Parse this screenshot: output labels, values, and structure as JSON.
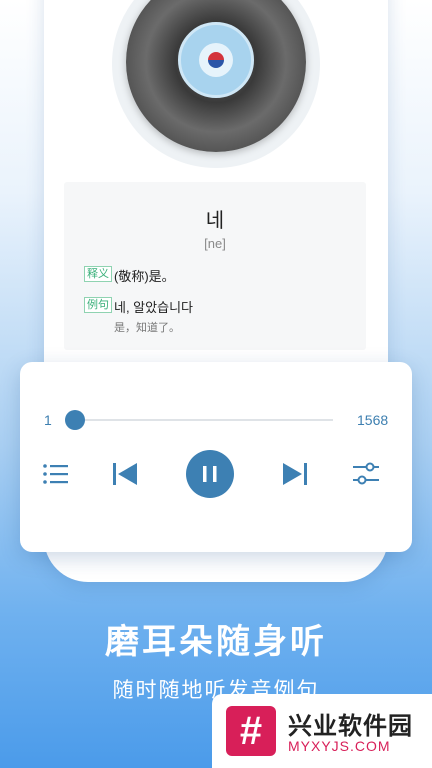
{
  "flashcard": {
    "word": "네",
    "phonetic": "[ne]",
    "meaning_tag": "释义",
    "meaning": "(敬称)是。",
    "example_tag": "例句",
    "example": "네, 알았습니다",
    "example_translation": "是，知道了。"
  },
  "player": {
    "progress_current": "1",
    "progress_total": "1568",
    "progress_fraction": 0.0,
    "icons": [
      "list-icon",
      "previous-icon",
      "pause-icon",
      "next-icon",
      "settings-sliders-icon"
    ]
  },
  "promo": {
    "headline": "磨耳朵随身听",
    "subline": "随时随地听发音例句"
  },
  "watermark": {
    "logo_char": "#",
    "title": "兴业软件园",
    "url": "MYXYJS.COM"
  },
  "colors": {
    "accent": "#3d80b3",
    "tag_green": "#3ab07a",
    "watermark_red": "#d81f59"
  }
}
